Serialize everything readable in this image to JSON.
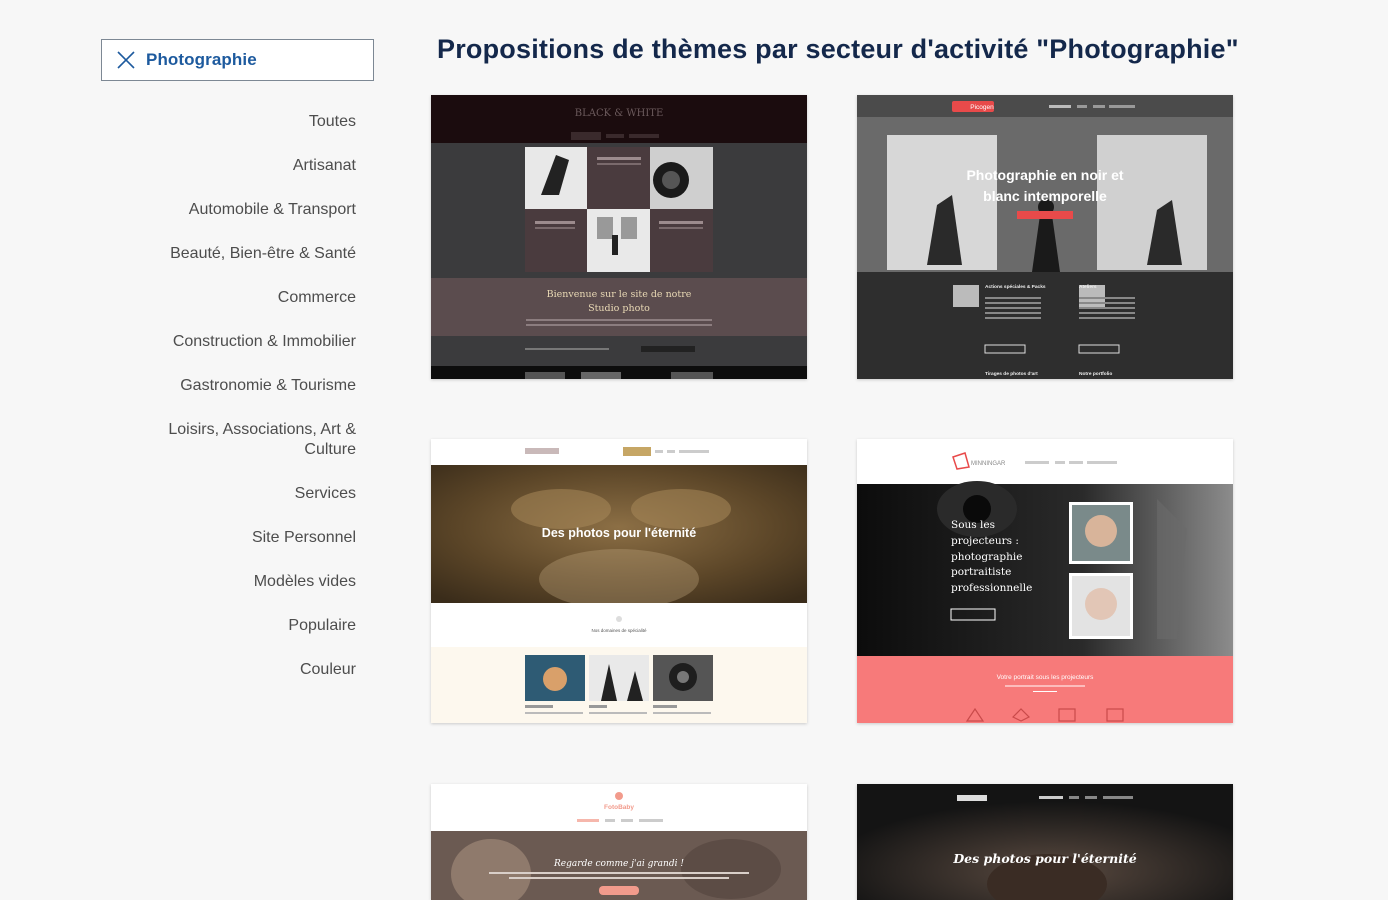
{
  "filter": {
    "active": "Photographie"
  },
  "sidebar": {
    "categories": [
      "Toutes",
      "Artisanat",
      "Automobile & Transport",
      "Beauté, Bien-être & Santé",
      "Commerce",
      "Construction & Immobilier",
      "Gastronomie & Tourisme",
      "Loisirs, Associations, Art &",
      "Culture",
      "Services",
      "Site Personnel",
      "Modèles vides",
      "Populaire",
      "Couleur"
    ]
  },
  "header": {
    "title": "Propositions de thèmes par secteur d'activité \"Photographie\""
  },
  "themes": [
    {
      "headline": "Bienvenue sur le site de notre",
      "headline2": "Studio photo",
      "logo": "BLACK & WHITE"
    },
    {
      "headline": "Photographie en noir et",
      "headline2": "blanc intemporelle",
      "logo": "Picogen",
      "sub1": "Actions spéciales & Packs",
      "sub2": "Ateliers",
      "sub3": "Tirages de photos d'art",
      "sub4": "Notre portfolio"
    },
    {
      "headline": "Des photos pour l'éternité",
      "sub": "Nos domaines de spécialité"
    },
    {
      "headline1": "Sous les",
      "headline2": "projecteurs :",
      "headline3": "photographie",
      "headline4": "portraitiste",
      "headline5": "professionnelle",
      "logo": "MINNINGAR",
      "band": "Votre portrait sous les projecteurs"
    },
    {
      "logo": "FotoBaby",
      "headline": "Regarde comme j'ai grandi !"
    },
    {
      "headline": "Des photos pour l'éternité"
    }
  ],
  "colors": {
    "accent": "#1d5a9e",
    "title": "#14284b",
    "coral": "#f77a7a",
    "red": "#e84a4a"
  }
}
